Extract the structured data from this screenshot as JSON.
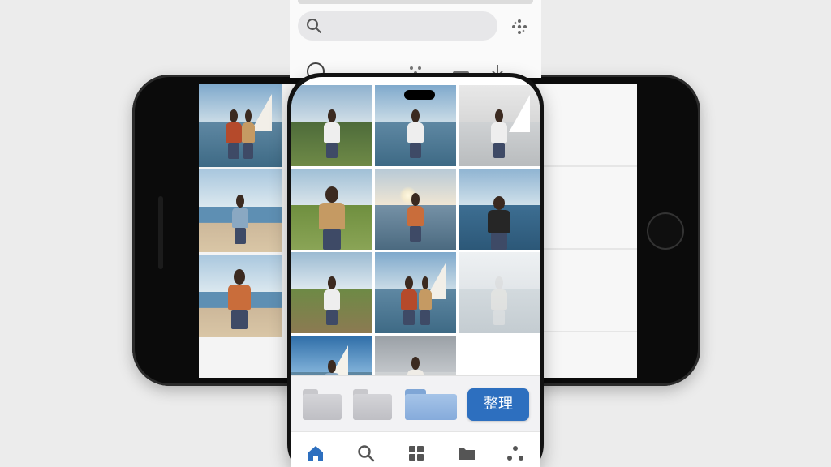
{
  "organize_label": "整理",
  "colors": {
    "accent": "#2d6fbf",
    "nav_active": "#2d6fbf",
    "nav_inactive": "#555555",
    "folder_blue": "#86abdb",
    "folder_grey": "#c4c4c8"
  },
  "top_panel": {
    "search_icon": "search-icon",
    "sparkle_icon": "sparkle-icon",
    "icons": [
      "circle-icon",
      "sparkle-icon",
      "minus-icon",
      "arrow-icon"
    ]
  },
  "photo_grid": [
    {
      "scene": "mountain",
      "subject": "woman-white-top"
    },
    {
      "scene": "lake",
      "subject": "woman-white-top"
    },
    {
      "scene": "white-sail",
      "subject": "woman-white-top"
    },
    {
      "scene": "field",
      "subject": "woman-tan-jacket"
    },
    {
      "scene": "sunset",
      "subject": "woman-orange"
    },
    {
      "scene": "sea",
      "subject": "man-dark-shirt"
    },
    {
      "scene": "hill",
      "subject": "woman-white-top"
    },
    {
      "scene": "lake-sail",
      "subject": "couple"
    },
    {
      "scene": "ghost",
      "subject": "faded-figure"
    },
    {
      "scene": "sail-blue",
      "subject": "man"
    },
    {
      "scene": "grey",
      "subject": "woman"
    },
    {
      "scene": "empty",
      "subject": ""
    }
  ],
  "landscape_grid": [
    {
      "scene": "sail",
      "subject": "couple"
    },
    {
      "scene": "beach",
      "subject": "man"
    },
    {
      "scene": "beach",
      "subject": "woman-orange"
    }
  ],
  "folders": [
    {
      "icon": "folder-icon",
      "style": "grey"
    },
    {
      "icon": "folder-icon",
      "style": "grey"
    },
    {
      "icon": "folder-open-icon",
      "style": "blue"
    }
  ],
  "bottom_nav": [
    {
      "icon": "home-icon",
      "active": true
    },
    {
      "icon": "search-icon",
      "active": false
    },
    {
      "icon": "grid-icon",
      "active": false
    },
    {
      "icon": "folder-icon",
      "active": false
    },
    {
      "icon": "share-icon",
      "active": false
    }
  ]
}
